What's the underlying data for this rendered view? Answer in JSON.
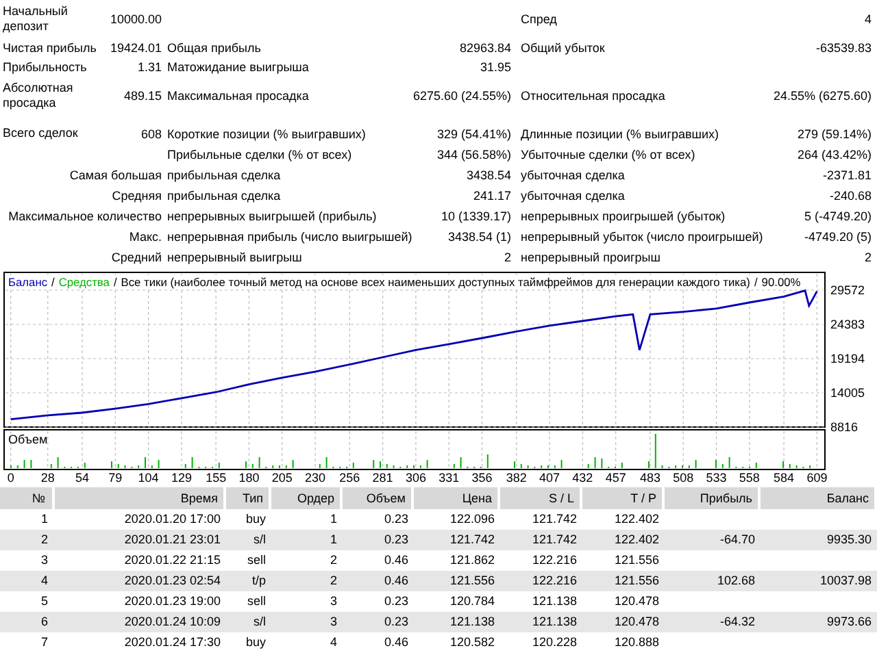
{
  "summary": {
    "sections": [
      [
        {
          "label": "Начальный депозит",
          "value": "10000.00",
          "label_3": "Спред",
          "value_3": "4"
        },
        {
          "label": "Чистая прибыль",
          "value": "19424.01",
          "label_2": "Общая прибыль",
          "value_2": "82963.84",
          "label_3": "Общий убыток",
          "value_3": "-63539.83"
        },
        {
          "label": "Прибыльность",
          "value": "1.31",
          "label_2": "Матожидание выигрыша",
          "value_2": "31.95"
        },
        {
          "label": "Абсолютная просадка",
          "value": "489.15",
          "label_2": "Максимальная просадка",
          "value_2": "6275.60 (24.55%)",
          "label_3": "Относительная просадка",
          "value_3": "24.55% (6275.60)"
        }
      ],
      [
        {
          "label": "Всего сделок",
          "value": "608",
          "label_2": "Короткие позиции (% выигравших)",
          "value_2": "329 (54.41%)",
          "label_3": "Длинные позиции (% выигравших)",
          "value_3": "279 (59.14%)"
        },
        {
          "label_2": "Прибыльные сделки (% от всех)",
          "value_2": "344 (56.58%)",
          "label_3": "Убыточные сделки (% от всех)",
          "value_3": "264 (43.42%)"
        },
        {
          "caption": "Самая большая",
          "label_2": "прибыльная сделка",
          "value_2": "3438.54",
          "label_3": "убыточная сделка",
          "value_3": "-2371.81"
        },
        {
          "caption": "Средняя",
          "label_2": "прибыльная сделка",
          "value_2": "241.17",
          "label_3": "убыточная сделка",
          "value_3": "-240.68"
        },
        {
          "caption": "Максимальное количество",
          "label_2": "непрерывных выигрышей (прибыль)",
          "value_2": "10 (1339.17)",
          "label_3": "непрерывных проигрышей (убыток)",
          "value_3": "5 (-4749.20)"
        },
        {
          "caption": "Макс.",
          "label_2": "непрерывная прибыль (число выигрышей)",
          "value_2": "3438.54 (1)",
          "label_3": "непрерывный убыток (число проигрышей)",
          "value_3": "-4749.20 (5)"
        },
        {
          "caption": "Средний",
          "label_2": "непрерывный выигрыш",
          "value_2": "2",
          "label_3": "непрерывный проигрыш",
          "value_3": "2"
        }
      ]
    ]
  },
  "chart": {
    "equity_legend": {
      "text": "Средства",
      "color": "#00b400"
    },
    "legend_separator": "/",
    "model_note": "Все тики (наиболее точный метод на основе всех наименьших доступных таймфреймов для генерации каждого тика)",
    "quality": "90.00%",
    "volume_label": "Объем",
    "chart_data": {
      "type": "line",
      "x": [
        0,
        28,
        54,
        79,
        104,
        129,
        155,
        180,
        205,
        230,
        256,
        281,
        306,
        331,
        356,
        382,
        407,
        432,
        457,
        470,
        475,
        483,
        508,
        533,
        558,
        584,
        600,
        603,
        609
      ],
      "series": [
        {
          "name": "Баланс",
          "color": "#0000b4",
          "values": [
            10000,
            10600,
            11000,
            11600,
            12300,
            13200,
            14100,
            15300,
            16300,
            17200,
            18300,
            19400,
            20500,
            21400,
            22300,
            23300,
            24200,
            24900,
            25600,
            25900,
            20500,
            25900,
            26300,
            26800,
            27700,
            28600,
            29500,
            27200,
            29400
          ]
        }
      ],
      "grid": true,
      "xlim": [
        -5,
        615
      ],
      "ylim": [
        8816,
        32271
      ],
      "xticks": [
        0,
        28,
        54,
        79,
        104,
        129,
        155,
        180,
        205,
        230,
        256,
        281,
        306,
        331,
        356,
        382,
        407,
        432,
        457,
        483,
        508,
        533,
        558,
        584,
        609
      ],
      "yticks": [
        8816,
        14005,
        19194,
        24383,
        29572
      ]
    }
  },
  "table": {
    "columns": [
      "№",
      "Время",
      "Тип",
      "Ордер",
      "Объем",
      "Цена",
      "S / L",
      "T / P",
      "Прибыль",
      "Баланс"
    ],
    "rows": [
      {
        "number": "1",
        "time": "2020.01.20 17:00",
        "type": "buy",
        "order": "1",
        "volume": "0.23",
        "price": "122.096",
        "sl": "121.742",
        "tp": "122.402"
      },
      {
        "number": "2",
        "time": "2020.01.21 23:01",
        "type": "s/l",
        "order": "1",
        "volume": "0.23",
        "price": "121.742",
        "sl": "121.742",
        "tp": "122.402",
        "profit": "-64.70",
        "balance": "9935.30"
      },
      {
        "number": "3",
        "time": "2020.01.22 21:15",
        "type": "sell",
        "order": "2",
        "volume": "0.46",
        "price": "121.862",
        "sl": "122.216",
        "tp": "121.556"
      },
      {
        "number": "4",
        "time": "2020.01.23 02:54",
        "type": "t/p",
        "order": "2",
        "volume": "0.46",
        "price": "121.556",
        "sl": "122.216",
        "tp": "121.556",
        "profit": "102.68",
        "balance": "10037.98"
      },
      {
        "number": "5",
        "time": "2020.01.23 19:00",
        "type": "sell",
        "order": "3",
        "volume": "0.23",
        "price": "120.784",
        "sl": "121.138",
        "tp": "120.478"
      },
      {
        "number": "6",
        "time": "2020.01.24 10:09",
        "type": "s/l",
        "order": "3",
        "volume": "0.23",
        "price": "121.138",
        "sl": "121.138",
        "tp": "120.478",
        "profit": "-64.32",
        "balance": "9973.66"
      },
      {
        "number": "7",
        "time": "2020.01.24 17:30",
        "type": "buy",
        "order": "4",
        "volume": "0.46",
        "price": "120.582",
        "sl": "120.228",
        "tp": "120.888"
      }
    ]
  }
}
